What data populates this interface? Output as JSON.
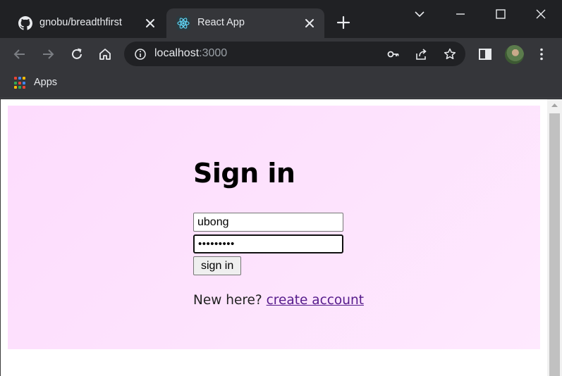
{
  "tabs": [
    {
      "title": "gnobu/breadthfirst",
      "icon": "github-icon",
      "active": false
    },
    {
      "title": "React App",
      "icon": "react-icon",
      "active": true
    }
  ],
  "toolbar": {
    "url_host": "localhost",
    "url_port": ":3000",
    "icons": [
      "back-icon",
      "forward-icon",
      "reload-icon",
      "home-icon",
      "site-info-icon",
      "key-icon",
      "share-icon",
      "star-icon",
      "side-panel-icon",
      "avatar",
      "menu-icon"
    ]
  },
  "bookmarks": {
    "apps_label": "Apps"
  },
  "page": {
    "heading": "Sign in",
    "username_value": "ubong",
    "password_value": "•••••••••",
    "signin_label": "sign in",
    "signup_prompt": "New here?",
    "signup_link": "create account"
  },
  "colors": {
    "chrome_dark": "#202124",
    "chrome_toolbar": "#35363a",
    "panel_pink": "#fde0fd",
    "link": "#551a8b"
  }
}
